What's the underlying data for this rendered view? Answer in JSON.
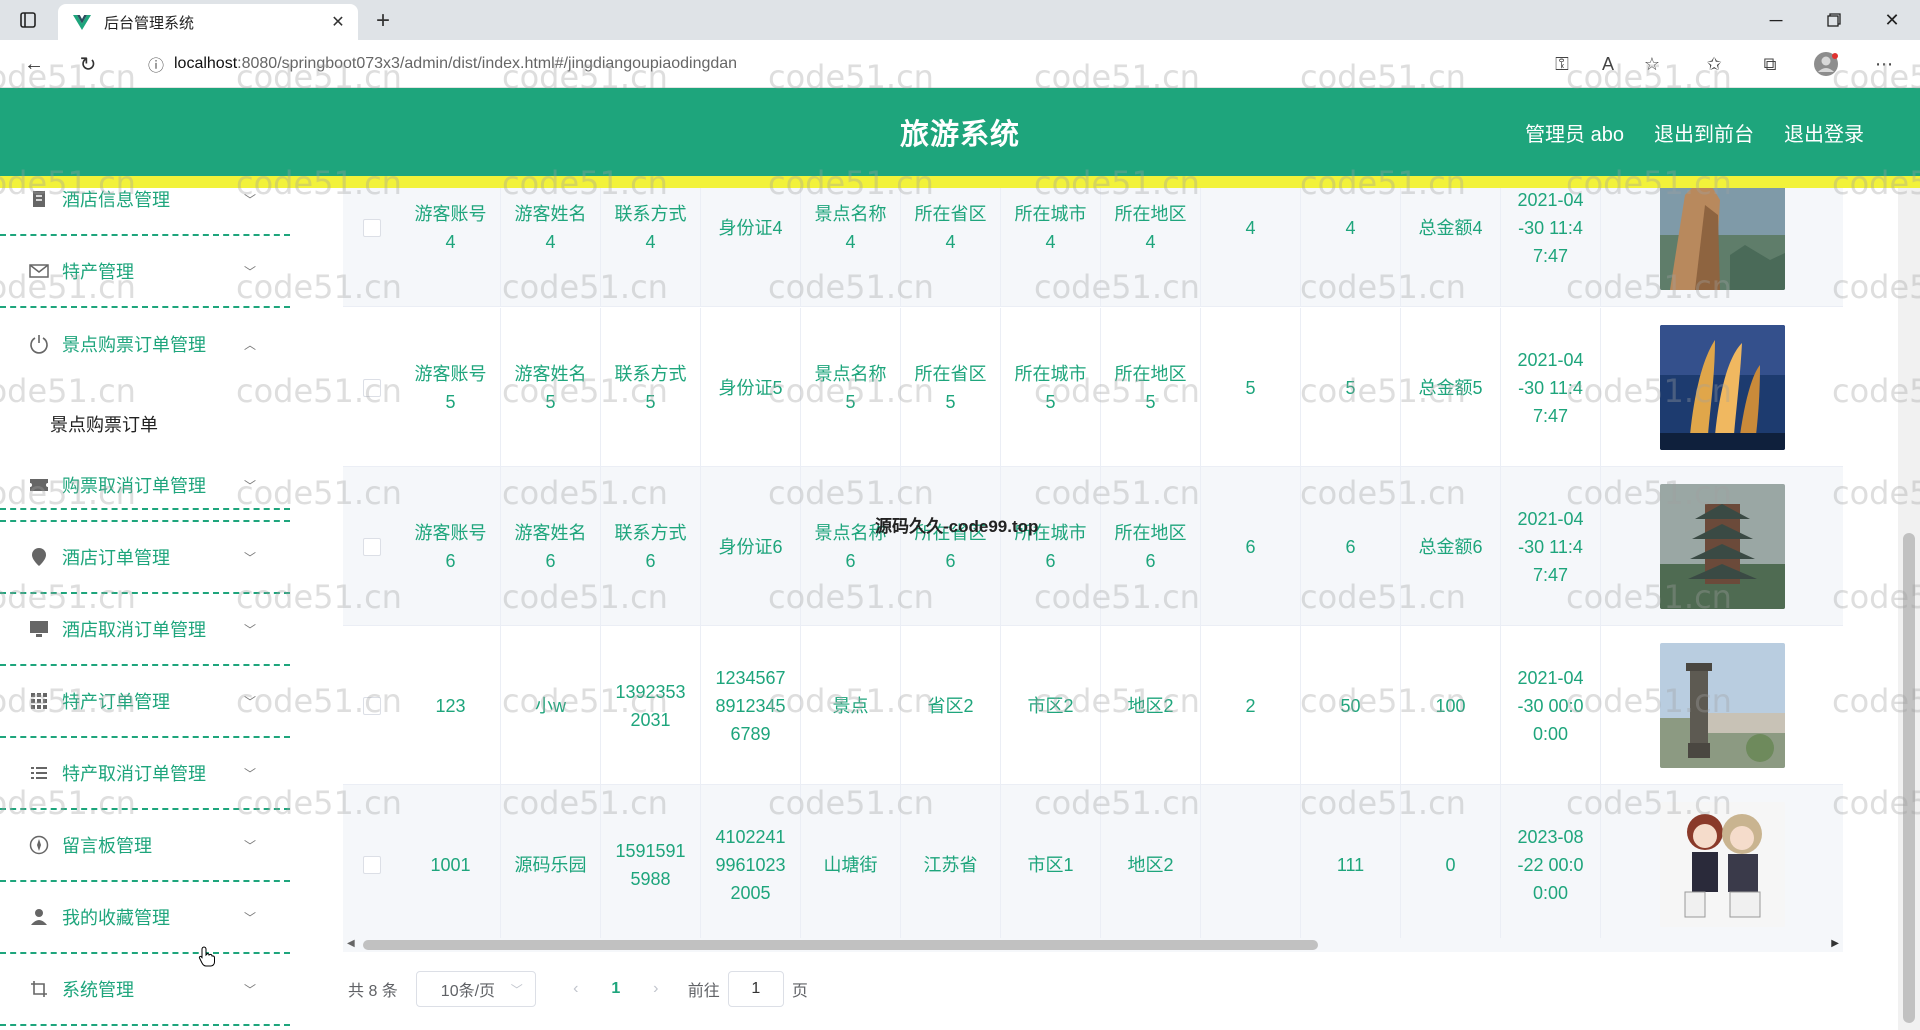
{
  "browser": {
    "tab_title": "后台管理系统",
    "url_host": "localhost",
    "url_path": ":8080/springboot073x3/admin/dist/index.html#/jingdiangoupiaodingdan"
  },
  "header": {
    "title": "旅游系统",
    "admin_label": "管理员 abo",
    "back_label": "退出到前台",
    "logout_label": "退出登录",
    "accent_color": "#1ea57c",
    "stripe_color": "#f2f23a"
  },
  "sidebar": {
    "items": [
      {
        "label": "酒店信息管理",
        "icon": "document-icon"
      },
      {
        "label": "特产管理",
        "icon": "mail-icon"
      },
      {
        "label": "景点购票订单管理",
        "icon": "power-icon",
        "expanded": true
      },
      {
        "label": "购票取消订单管理",
        "icon": "ticket-icon"
      },
      {
        "label": "酒店订单管理",
        "icon": "location-icon"
      },
      {
        "label": "酒店取消订单管理",
        "icon": "monitor-icon"
      },
      {
        "label": "特产订单管理",
        "icon": "grid-icon"
      },
      {
        "label": "特产取消订单管理",
        "icon": "list-icon"
      },
      {
        "label": "留言板管理",
        "icon": "compass-icon"
      },
      {
        "label": "我的收藏管理",
        "icon": "user-icon"
      },
      {
        "label": "系统管理",
        "icon": "crop-icon"
      }
    ],
    "submenu_label": "景点购票订单"
  },
  "table": {
    "rows": [
      {
        "account": "游客账号\n4",
        "name": "游客姓名\n4",
        "phone": "联系方式\n4",
        "id_card": "身份证4",
        "spot": "景点名称\n4",
        "province": "所在省区\n4",
        "city": "所在城市\n4",
        "district": "所在地区\n4",
        "qty": "4",
        "price": "4",
        "total": "总金额4",
        "date": "2021-04\n-30 11:4\n7:47",
        "image": "cliff"
      },
      {
        "account": "游客账号\n5",
        "name": "游客姓名\n5",
        "phone": "联系方式\n5",
        "id_card": "身份证5",
        "spot": "景点名称\n5",
        "province": "所在省区\n5",
        "city": "所在城市\n5",
        "district": "所在地区\n5",
        "qty": "5",
        "price": "5",
        "total": "总金额5",
        "date": "2021-04\n-30 11:4\n7:47",
        "image": "sails"
      },
      {
        "account": "游客账号\n6",
        "name": "游客姓名\n6",
        "phone": "联系方式\n6",
        "id_card": "身份证6",
        "spot": "景点名称\n6",
        "province": "所在省区\n6",
        "city": "所在城市\n6",
        "district": "所在地区\n6",
        "qty": "6",
        "price": "6",
        "total": "总金额6",
        "date": "2021-04\n-30 11:4\n7:47",
        "image": "pagoda"
      },
      {
        "account": "123",
        "name": "小w",
        "phone": "1392353\n2031",
        "id_card": "1234567\n8912345\n6789",
        "spot": "景点",
        "province": "省区2",
        "city": "市区2",
        "district": "地区2",
        "qty": "2",
        "price": "50",
        "total": "100",
        "date": "2021-04\n-30 00:0\n0:00",
        "image": "monument"
      },
      {
        "account": "1001",
        "name": "源码乐园",
        "phone": "1591591\n5988",
        "id_card": "4102241\n9961023\n2005",
        "spot": "山塘街",
        "province": "江苏省",
        "city": "市区1",
        "district": "地区2",
        "qty": "",
        "price": "111",
        "total": "0",
        "date": "2023-08\n-22 00:0\n0:00",
        "image": "anime"
      }
    ]
  },
  "pagination": {
    "total_text": "共 8 条",
    "page_size": "10条/页",
    "current_page": "1",
    "goto_label": "前往",
    "goto_value": "1",
    "page_suffix": "页"
  },
  "overlay": {
    "watermark": "code51.cn",
    "center_text": "源码久久-code99.top"
  }
}
